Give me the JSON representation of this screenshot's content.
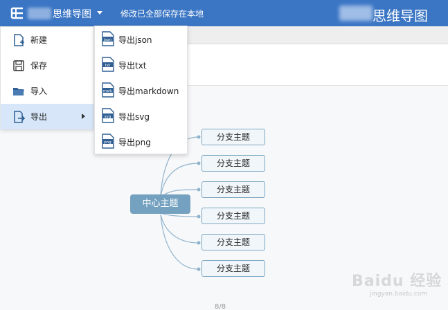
{
  "header": {
    "app_title": "思维导图",
    "save_status": "修改已全部保存在本地",
    "brand": "思维导图"
  },
  "file_menu": {
    "items": [
      {
        "label": "新建",
        "icon": "new-file-icon"
      },
      {
        "label": "保存",
        "icon": "save-icon"
      },
      {
        "label": "导入",
        "icon": "folder-icon"
      },
      {
        "label": "导出",
        "icon": "export-icon",
        "active": true
      }
    ]
  },
  "export_menu": {
    "items": [
      {
        "label": "导出json",
        "tag": "json"
      },
      {
        "label": "导出txt",
        "tag": "txt"
      },
      {
        "label": "导出markdown",
        "tag": "mark"
      },
      {
        "label": "导出svg",
        "tag": "svg"
      },
      {
        "label": "导出png",
        "tag": "png"
      }
    ]
  },
  "mindmap": {
    "root": "中心主题",
    "branches": [
      "分支主题",
      "分支主题",
      "分支主题",
      "分支主题",
      "分支主题",
      "分支主题"
    ],
    "line_color": "#8fb3cc"
  },
  "footer": {
    "page_indicator": "8/8"
  },
  "watermark": {
    "brand": "Baidu 经验",
    "url": "jingyan.baidu.com"
  }
}
